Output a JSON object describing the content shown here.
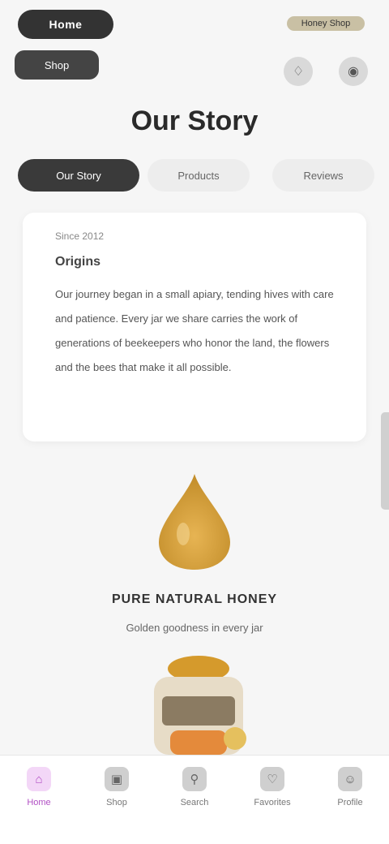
{
  "header": {
    "logo": "Home",
    "logo_sub": "Shop",
    "badge": "Honey Shop",
    "icon_one": "bell-icon",
    "icon_two": "cart-icon"
  },
  "page": {
    "title": "Our Story"
  },
  "tabs": [
    {
      "label": "Our Story",
      "active": true
    },
    {
      "label": "Products",
      "active": false
    },
    {
      "label": "Reviews",
      "active": false
    }
  ],
  "article": {
    "kicker": "Since 2012",
    "heading": "Origins",
    "body": "Our journey began in a small apiary, tending hives with care and patience. Every jar we share carries the work of generations of beekeepers who honor the land, the flowers and the bees that make it all possible."
  },
  "promo": {
    "title": "PURE NATURAL HONEY",
    "subtitle": "Golden goodness in every jar"
  },
  "bottom_nav": [
    {
      "label": "Home",
      "icon": "home-icon",
      "active": true
    },
    {
      "label": "Shop",
      "icon": "bag-icon",
      "active": false
    },
    {
      "label": "Search",
      "icon": "search-icon",
      "active": false
    },
    {
      "label": "Favorites",
      "icon": "heart-icon",
      "active": false
    },
    {
      "label": "Profile",
      "icon": "user-icon",
      "active": false
    }
  ],
  "colors": {
    "accent": "#b14fc4",
    "honey": "#d7a23a",
    "dark": "#333333"
  }
}
